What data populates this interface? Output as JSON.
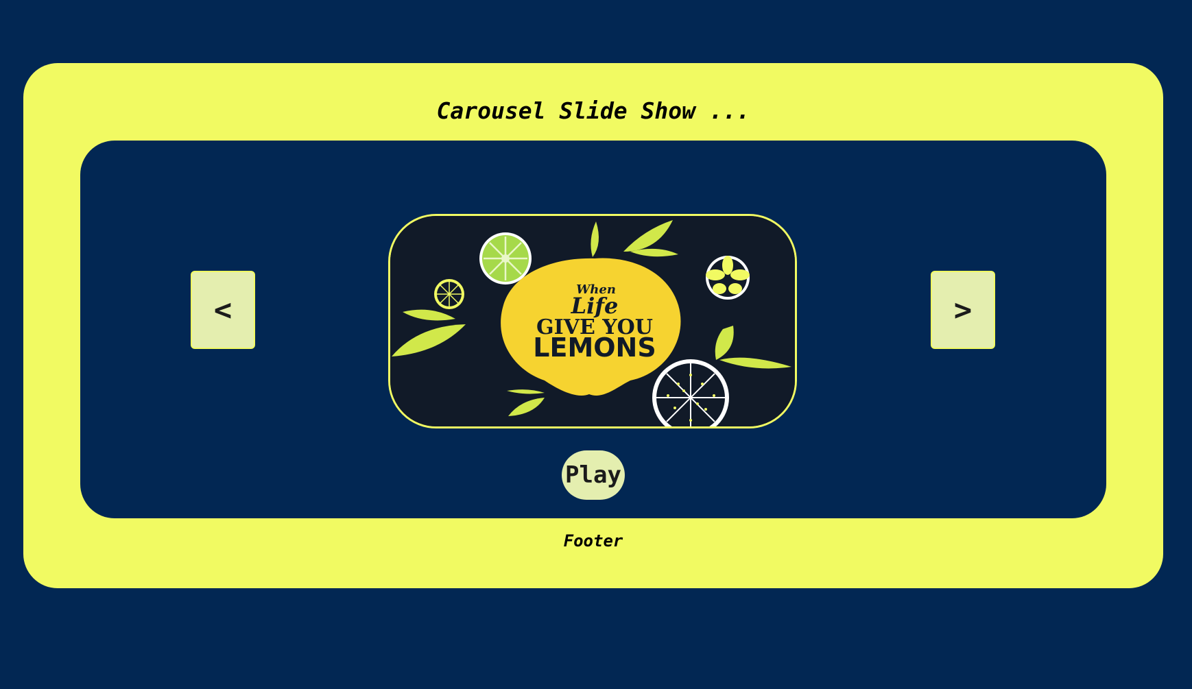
{
  "header": {
    "title": "Carousel Slide Show ..."
  },
  "carousel": {
    "prev_label": "<",
    "next_label": ">",
    "slide": {
      "line1": "When",
      "line2": "Life",
      "line3": "GIVE YOU",
      "line4": "LEMONS"
    },
    "play_label": "Play"
  },
  "footer": {
    "text": "Footer"
  },
  "colors": {
    "background": "#022753",
    "frame": "#f1fa62",
    "button": "#e4eeaf",
    "slide_bg": "#111a28",
    "lemon": "#f6d330",
    "leaf": "#d1e84a"
  }
}
